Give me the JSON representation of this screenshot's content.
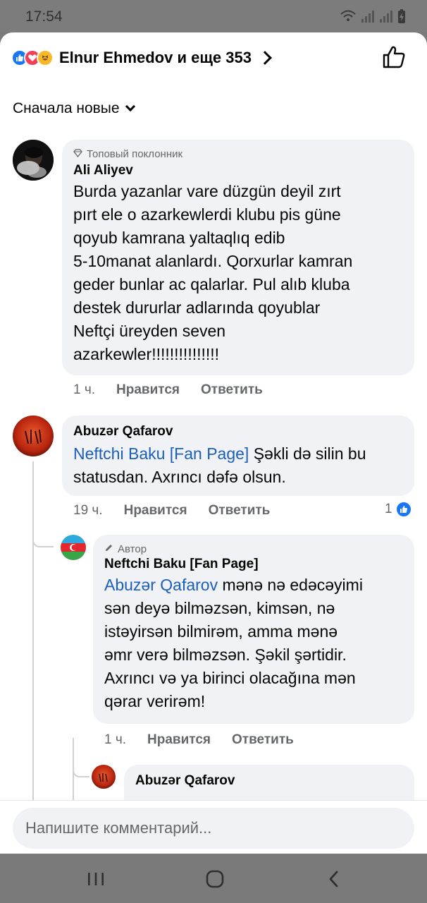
{
  "status": {
    "time": "17:54"
  },
  "header": {
    "reactors_text": "Elnur Ehmedov и еще 353",
    "sort_label": "Сначала новые"
  },
  "comments": [
    {
      "badge": "Топовый поклонник",
      "author": "Ali Aliyev",
      "text_lines": [
        "Burda yazanlar vare düzgün deyil zırt",
        "pırt ele o azarkewlerdi klubu pis güne",
        "qoyub kamrana yaltaqlıq edib",
        "5-10manat alanlardı. Qorxurlar kamran",
        "geder bunlar ac qalarlar. Pul alıb kluba",
        "destek dururlar adlarında qoyublar",
        "Neftçi üreyden seven",
        "azarkewler!!!!!!!!!!!!!!!"
      ],
      "time": "1 ч.",
      "like_label": "Нравится",
      "reply_label": "Ответить"
    },
    {
      "author": "Abuzər Qafarov",
      "mention": "Neftchi Baku [Fan Page]",
      "text_line1_rest": " Şəkli də silin bu",
      "text_line2": "statusdan. Axrıncı dəfə olsun.",
      "time": "19 ч.",
      "like_label": "Нравится",
      "reply_label": "Ответить",
      "reaction_count": "1"
    },
    {
      "badge": "Автор",
      "author": "Neftchi Baku [Fan Page]",
      "mention": "Abuzər Qafarov",
      "text_line1_rest": " mənə nə edəcəyimi",
      "text_lines": [
        "sən deyə bilməzsən, kimsən, nə",
        "istəyirsən bilmirəm, amma mənə",
        "əmr verə bilməzsən. Şəkil şərtidir.",
        "Axrıncı və ya birinci olacağına mən",
        "qərar verirəm!"
      ],
      "time": "1 ч.",
      "like_label": "Нравится",
      "reply_label": "Ответить"
    },
    {
      "author": "Abuzər Qafarov"
    }
  ],
  "composer": {
    "placeholder": "Напишите комментарий..."
  },
  "icons": {
    "like": "like-icon",
    "love": "love-icon",
    "haha": "haha-icon",
    "thumbs_up": "thumbs-up-icon",
    "nav_recents": "recents-icon",
    "nav_home": "home-icon",
    "nav_back": "back-icon"
  },
  "colors": {
    "link": "#1b5fb8",
    "fb_blue": "#1877f2",
    "bubble": "#f0f2f5",
    "meta_gray": "#65676b"
  }
}
